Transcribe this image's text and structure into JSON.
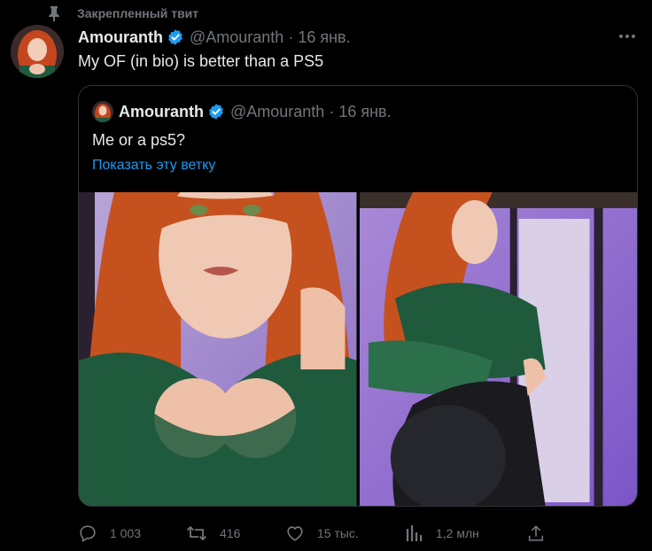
{
  "pinned": {
    "label": "Закрепленный твит",
    "icon": "pin-icon"
  },
  "tweet": {
    "author_name": "Amouranth",
    "handle": "@Amouranth",
    "separator": "·",
    "date": "16 янв.",
    "text": "My OF (in bio) is better than a PS5",
    "more_icon": "more-icon"
  },
  "quote": {
    "author_name": "Amouranth",
    "handle": "@Amouranth",
    "separator": "·",
    "date": "16 янв.",
    "text": "Me or a ps5?",
    "show_thread": "Показать эту ветку"
  },
  "actions": {
    "reply": {
      "icon": "reply-icon",
      "count": "1 003"
    },
    "retweet": {
      "icon": "retweet-icon",
      "count": "416"
    },
    "like": {
      "icon": "heart-icon",
      "count": "15 тыс."
    },
    "views": {
      "icon": "views-icon",
      "count": "1,2 млн"
    },
    "share": {
      "icon": "share-icon"
    }
  },
  "colors": {
    "background": "#000000",
    "text_primary": "#e7e9ea",
    "text_secondary": "#71767b",
    "link": "#1d9bf0",
    "verified": "#1d9bf0",
    "border": "#2f3336"
  }
}
